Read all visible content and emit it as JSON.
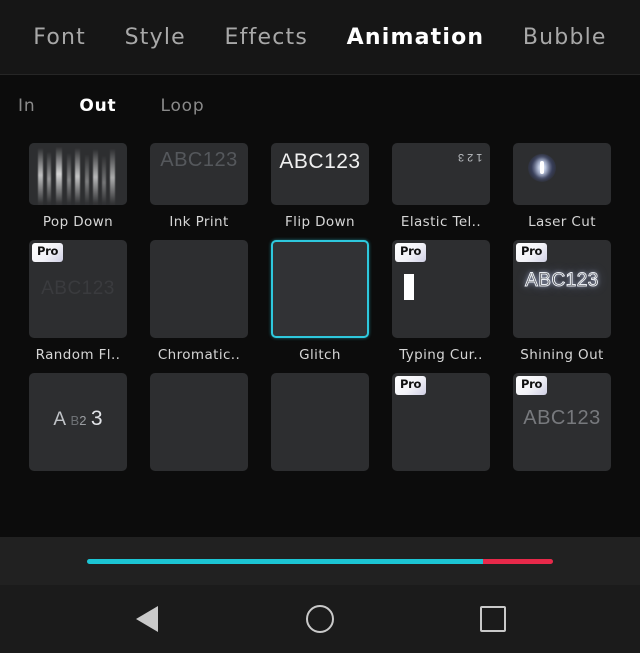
{
  "top_tabs": [
    {
      "label": "Font",
      "active": false
    },
    {
      "label": "Style",
      "active": false
    },
    {
      "label": "Effects",
      "active": false
    },
    {
      "label": "Animation",
      "active": true
    },
    {
      "label": "Bubble",
      "active": false
    }
  ],
  "sub_tabs": [
    {
      "label": "In",
      "active": false
    },
    {
      "label": "Out",
      "active": true
    },
    {
      "label": "Loop",
      "active": false
    }
  ],
  "presets": {
    "row1": [
      {
        "label": "Pop Down",
        "art": "streaks",
        "pro": false,
        "selected": false,
        "sample": ""
      },
      {
        "label": "Ink Print",
        "art": "ink",
        "pro": false,
        "selected": false,
        "sample": "ABC123"
      },
      {
        "label": "Flip Down",
        "art": "flip",
        "pro": false,
        "selected": false,
        "sample": "ABC123"
      },
      {
        "label": "Elastic Tel..",
        "art": "elastic",
        "pro": false,
        "selected": false,
        "sample": "123"
      },
      {
        "label": "Laser Cut",
        "art": "laser",
        "pro": false,
        "selected": false,
        "sample": ""
      }
    ],
    "row2": [
      {
        "label": "Random Fl..",
        "art": "faint",
        "pro": true,
        "selected": false,
        "sample": "ABC123"
      },
      {
        "label": "Chromatic..",
        "art": "none",
        "pro": false,
        "selected": false,
        "sample": ""
      },
      {
        "label": "Glitch",
        "art": "none",
        "pro": false,
        "selected": true,
        "sample": ""
      },
      {
        "label": "Typing Cur..",
        "art": "cursor",
        "pro": true,
        "selected": false,
        "sample": ""
      },
      {
        "label": "Shining Out",
        "art": "shining",
        "pro": true,
        "selected": false,
        "sample": "ABC123"
      }
    ],
    "row3": [
      {
        "label": "",
        "art": "scatter",
        "pro": false,
        "selected": false,
        "sample_parts": [
          "A",
          "B",
          "2",
          "3"
        ]
      },
      {
        "label": "",
        "art": "none",
        "pro": false,
        "selected": false,
        "sample": ""
      },
      {
        "label": "",
        "art": "none",
        "pro": false,
        "selected": false,
        "sample": ""
      },
      {
        "label": "",
        "art": "none",
        "pro": true,
        "selected": false,
        "sample": ""
      },
      {
        "label": "",
        "art": "gray",
        "pro": true,
        "selected": false,
        "sample": "ABC123"
      }
    ]
  },
  "pro_badge_label": "Pro",
  "progress": {
    "played_percent": 85,
    "remaining_percent": 15,
    "played_color": "#1cc5d4",
    "remaining_color": "#e8294a"
  },
  "selection_color": "#2ec8dd",
  "navbar": {
    "back_label": "Back",
    "home_label": "Home",
    "recents_label": "Recents"
  }
}
